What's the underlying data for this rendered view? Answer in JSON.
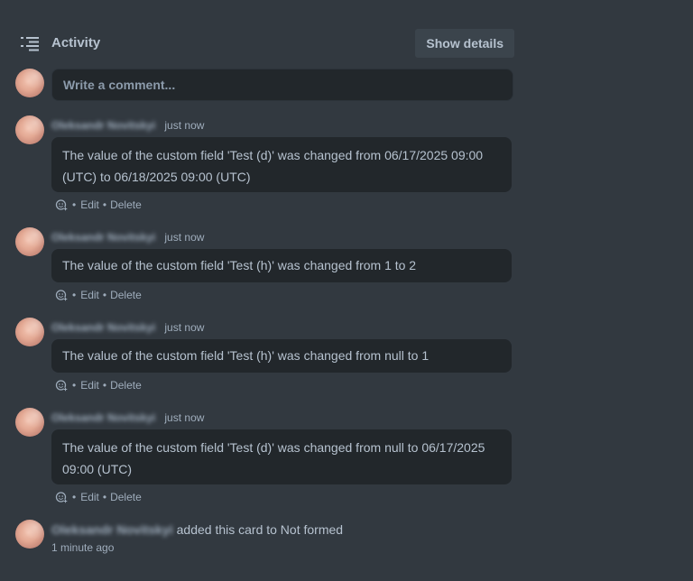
{
  "activity": {
    "title": "Activity",
    "show_details_label": "Show details",
    "comment_placeholder": "Write a comment..."
  },
  "entries": [
    {
      "author": "Oleksandr Novitskyi",
      "time": "just now",
      "message": "The value of the custom field 'Test (d)' was changed from 06/17/2025 09:00 (UTC) to 06/18/2025 09:00 (UTC)",
      "dot": "•",
      "edit": "Edit",
      "delete": "Delete"
    },
    {
      "author": "Oleksandr Novitskyi",
      "time": "just now",
      "message": "The value of the custom field 'Test (h)' was changed from 1 to 2",
      "dot": "•",
      "edit": "Edit",
      "delete": "Delete"
    },
    {
      "author": "Oleksandr Novitskyi",
      "time": "just now",
      "message": "The value of the custom field 'Test (h)' was changed from null to 1",
      "dot": "•",
      "edit": "Edit",
      "delete": "Delete"
    },
    {
      "author": "Oleksandr Novitskyi",
      "time": "just now",
      "message": "The value of the custom field 'Test (d)' was changed from null to 06/17/2025 09:00 (UTC)",
      "dot": "•",
      "edit": "Edit",
      "delete": "Delete"
    }
  ],
  "card_event": {
    "author": "Oleksandr Novitskyi",
    "text": "added this card to Not formed",
    "time": "1 minute ago"
  },
  "icons": {
    "activity": "list-icon",
    "reaction": "add-reaction-icon"
  }
}
